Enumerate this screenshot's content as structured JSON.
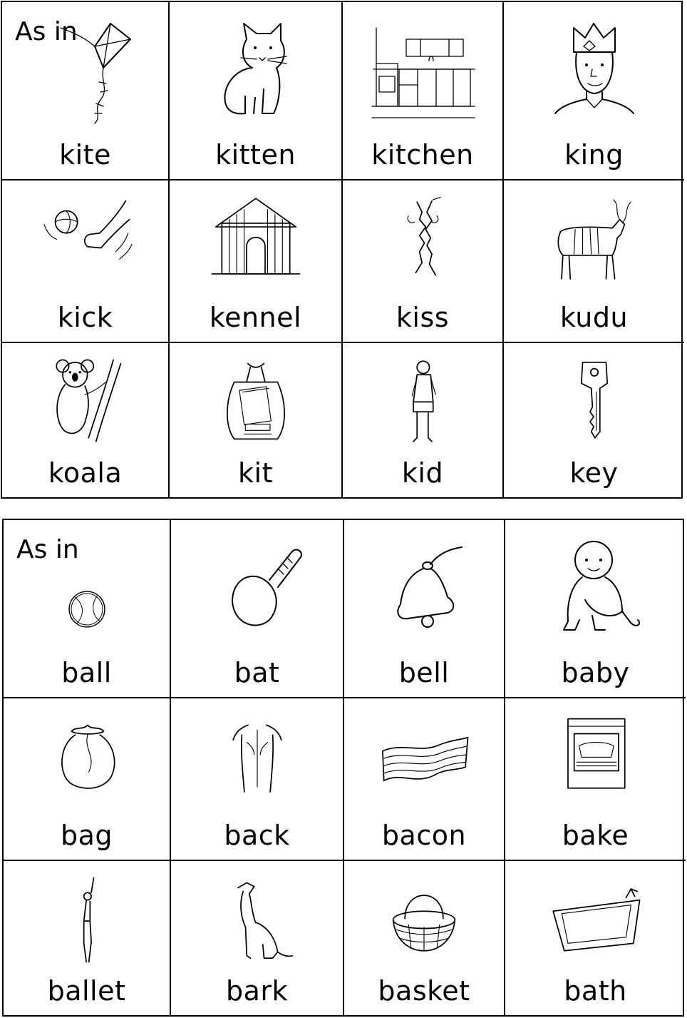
{
  "sheets": [
    {
      "as_in": "As in",
      "cells": [
        {
          "word": "kite",
          "icon": "kite-icon"
        },
        {
          "word": "kitten",
          "icon": "kitten-icon"
        },
        {
          "word": "kitchen",
          "icon": "kitchen-icon"
        },
        {
          "word": "king",
          "icon": "king-icon"
        },
        {
          "word": "kick",
          "icon": "kick-icon"
        },
        {
          "word": "kennel",
          "icon": "kennel-icon"
        },
        {
          "word": "kiss",
          "icon": "kiss-icon"
        },
        {
          "word": "kudu",
          "icon": "kudu-icon"
        },
        {
          "word": "koala",
          "icon": "koala-icon"
        },
        {
          "word": "kit",
          "icon": "kit-icon"
        },
        {
          "word": "kid",
          "icon": "kid-icon"
        },
        {
          "word": "key",
          "icon": "key-icon"
        }
      ]
    },
    {
      "as_in": "As in",
      "cells": [
        {
          "word": "ball",
          "icon": "ball-icon"
        },
        {
          "word": "bat",
          "icon": "bat-icon"
        },
        {
          "word": "bell",
          "icon": "bell-icon"
        },
        {
          "word": "baby",
          "icon": "baby-icon"
        },
        {
          "word": "bag",
          "icon": "bag-icon"
        },
        {
          "word": "back",
          "icon": "back-icon"
        },
        {
          "word": "bacon",
          "icon": "bacon-icon"
        },
        {
          "word": "bake",
          "icon": "bake-icon"
        },
        {
          "word": "ballet",
          "icon": "ballet-icon"
        },
        {
          "word": "bark",
          "icon": "bark-icon"
        },
        {
          "word": "basket",
          "icon": "basket-icon"
        },
        {
          "word": "bath",
          "icon": "bath-icon"
        }
      ]
    }
  ]
}
